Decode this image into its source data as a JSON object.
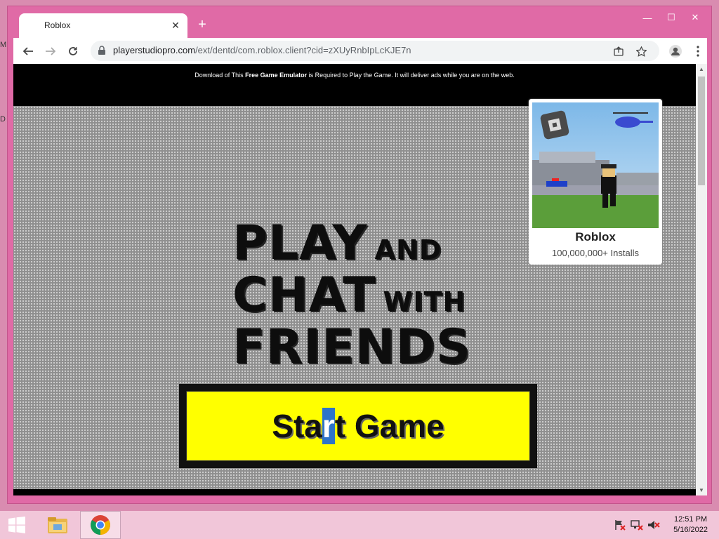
{
  "desktop": {
    "edge_letters": [
      "M",
      "D"
    ]
  },
  "browser": {
    "tab_title": "Roblox",
    "tab_close": "✕",
    "new_tab": "+",
    "url_host": "playerstudiopro.com",
    "url_path": "/ext/dentd/com.roblox.client?cid=zXUyRnbIpLcKJE7n",
    "window_controls": {
      "minimize": "—",
      "maximize": "☐",
      "close": "✕"
    }
  },
  "page": {
    "banner": {
      "prefix": "Download of This ",
      "bold": "Free Game Emulator",
      "suffix": " is Required to Play the Game. It will deliver ads while you are on the web."
    },
    "headline": {
      "line1_big": "PLAY",
      "line1_small": "AND",
      "line2_big": "CHAT",
      "line2_small": "WITH",
      "line3_big": "FRIENDS"
    },
    "start_button": {
      "before": "Sta",
      "selected": "r",
      "after": "t Game"
    },
    "app_card": {
      "title": "Roblox",
      "installs": "100,000,000+ Installs"
    }
  },
  "taskbar": {
    "time": "12:51 PM",
    "date": "5/16/2022"
  },
  "colors": {
    "window_frame": "#e06aa6",
    "start_button": "#ffff00",
    "selection": "#2e74c9",
    "taskbar": "#f1c6d9"
  }
}
